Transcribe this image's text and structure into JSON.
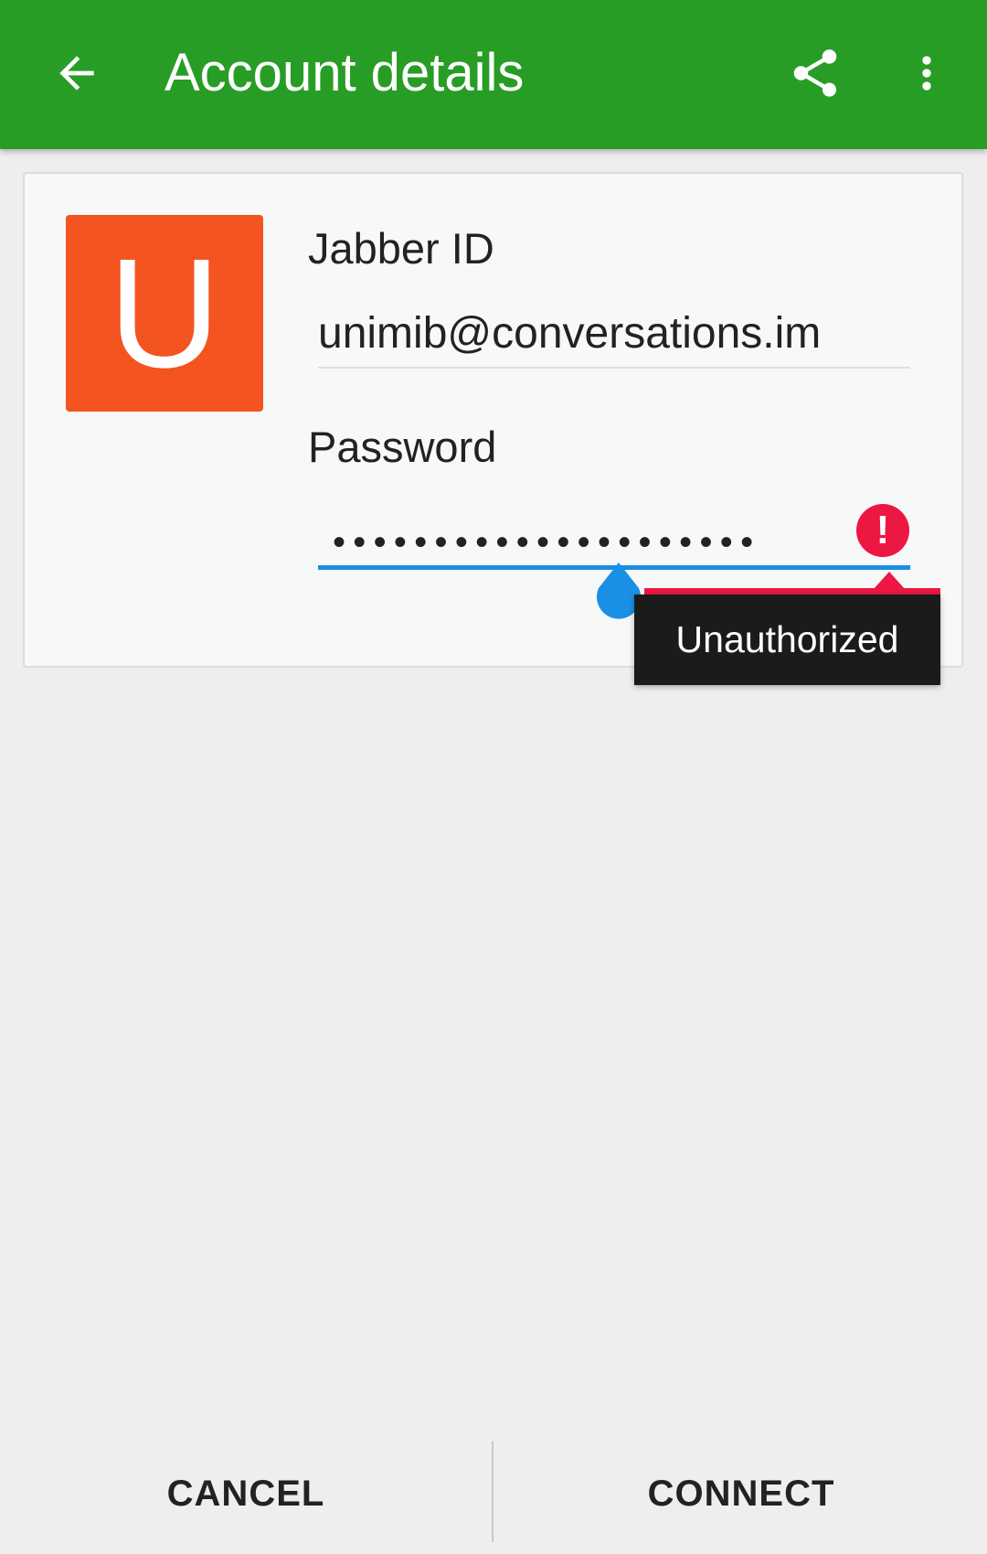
{
  "appbar": {
    "title": "Account details",
    "back_icon": "arrow-left-icon",
    "share_icon": "share-icon",
    "overflow_icon": "more-vertical-icon",
    "color": "#289d25"
  },
  "account": {
    "avatar_letter": "U",
    "avatar_color": "#f45420",
    "jid_label": "Jabber ID",
    "jid_value": "unimib@conversations.im",
    "password_label": "Password",
    "password_value": "•••••••••••••••••••••",
    "error_icon": "error-exclamation-icon",
    "error_text": "Unauthorized",
    "error_color": "#ec1842",
    "accent_color": "#1a8fe4"
  },
  "actions": {
    "cancel_label": "CANCEL",
    "connect_label": "CONNECT"
  }
}
